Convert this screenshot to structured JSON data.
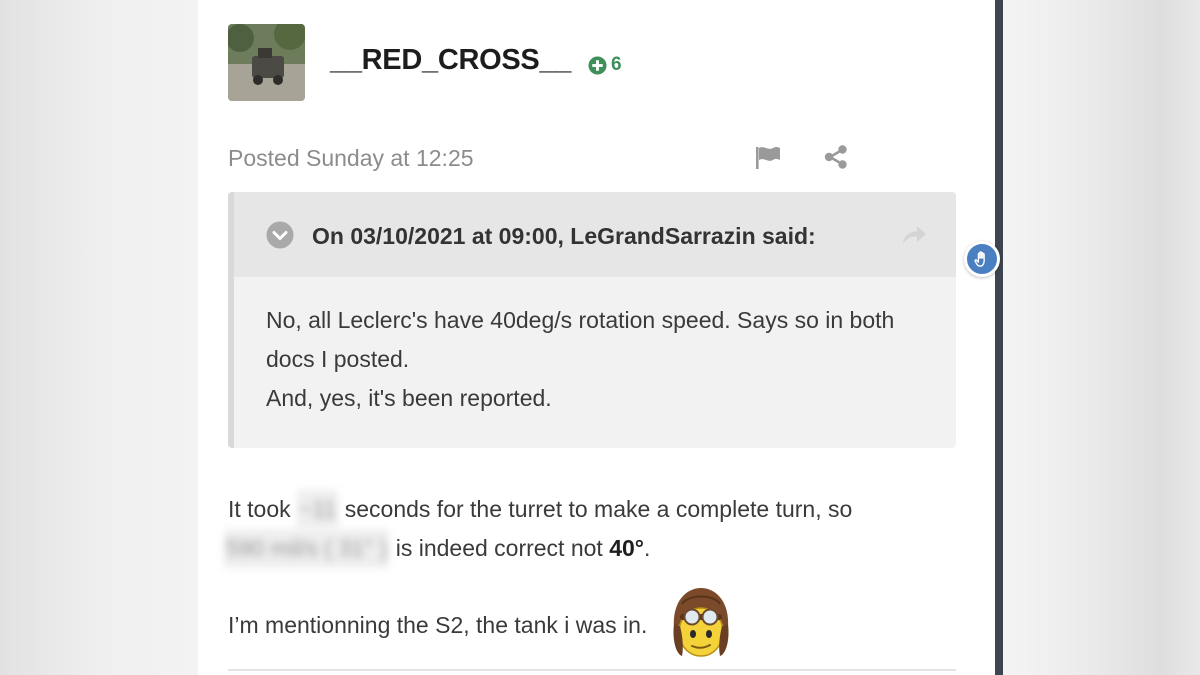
{
  "author": {
    "username": "__RED_CROSS__",
    "reputation_sign": "+",
    "reputation": "6"
  },
  "post": {
    "posted_label": "Posted Sunday at 12:25"
  },
  "quote": {
    "citation": "On 03/10/2021 at 09:00, LeGrandSarrazin said:",
    "lines": [
      "No, all Leclerc's have 40deg/s rotation speed. Says so in both docs I posted.",
      "And, yes, it's been reported."
    ]
  },
  "body": {
    "l1_start": "It took",
    "l1_blur": "~11",
    "l1_end": "seconds for the turret to make a complete turn, so",
    "l2_blur": "590 mil/s ( 31° )",
    "l2_text": "is indeed correct not",
    "l2_bold": "40°",
    "l2_end": ".",
    "l3": "I’m mentionning the S2, the tank i was in."
  },
  "icons": {
    "report": "flag-icon",
    "share": "share-icon",
    "rep": "plus-circle-icon",
    "toggle": "chevron-down-circle-icon",
    "goto": "reply-arrow-icon",
    "emoji": "aviator-smiley-icon",
    "handle": "hand-icon"
  },
  "colors": {
    "reputation": "#3f8f5a",
    "handle": "#4a7fc1",
    "rail": "#3d4550"
  }
}
